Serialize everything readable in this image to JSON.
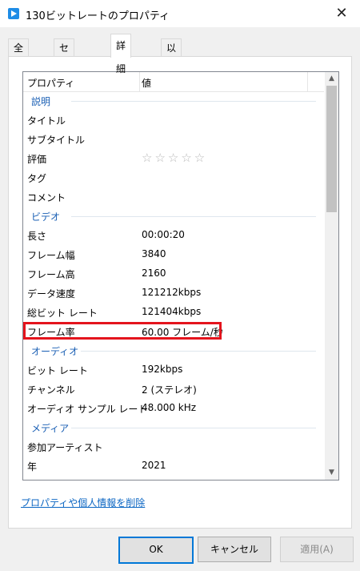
{
  "window": {
    "title": "130ビットレートのプロパティ",
    "close_glyph": "✕"
  },
  "tabs": [
    {
      "label": "全般"
    },
    {
      "label": "セキュリティ"
    },
    {
      "label": "詳細"
    },
    {
      "label": "以前のバージョン"
    }
  ],
  "list": {
    "header": {
      "property": "プロパティ",
      "value": "値"
    },
    "groups": {
      "description": "説明",
      "video": "ビデオ",
      "audio": "オーディオ",
      "media": "メディア"
    },
    "rows": {
      "title": {
        "key": "タイトル",
        "value": ""
      },
      "subtitle": {
        "key": "サブタイトル",
        "value": ""
      },
      "rating": {
        "key": "評価",
        "value": "☆☆☆☆☆"
      },
      "tags": {
        "key": "タグ",
        "value": ""
      },
      "comment": {
        "key": "コメント",
        "value": ""
      },
      "length": {
        "key": "長さ",
        "value": "00:00:20"
      },
      "frame_width": {
        "key": "フレーム幅",
        "value": "3840"
      },
      "frame_height": {
        "key": "フレーム高",
        "value": "2160"
      },
      "data_rate": {
        "key": "データ速度",
        "value": "121212kbps"
      },
      "total_bitrate": {
        "key": "総ビット レート",
        "value": "121404kbps"
      },
      "frame_rate": {
        "key": "フレーム率",
        "value": "60.00 フレーム/秒"
      },
      "bitrate": {
        "key": "ビット レート",
        "value": "192kbps"
      },
      "channels": {
        "key": "チャンネル",
        "value": "2 (ステレオ)"
      },
      "sample_rate": {
        "key": "オーディオ サンプル レート",
        "value": "48.000 kHz"
      },
      "contributing_artists": {
        "key": "参加アーティスト",
        "value": ""
      },
      "year": {
        "key": "年",
        "value": "2021"
      }
    }
  },
  "remove_link": "プロパティや個人情報を削除",
  "buttons": {
    "ok": "OK",
    "cancel": "キャンセル",
    "apply": "適用(A)"
  },
  "colors": {
    "highlight": "#e4141d",
    "group_text": "#1a5fb4",
    "link": "#0b66c3"
  }
}
